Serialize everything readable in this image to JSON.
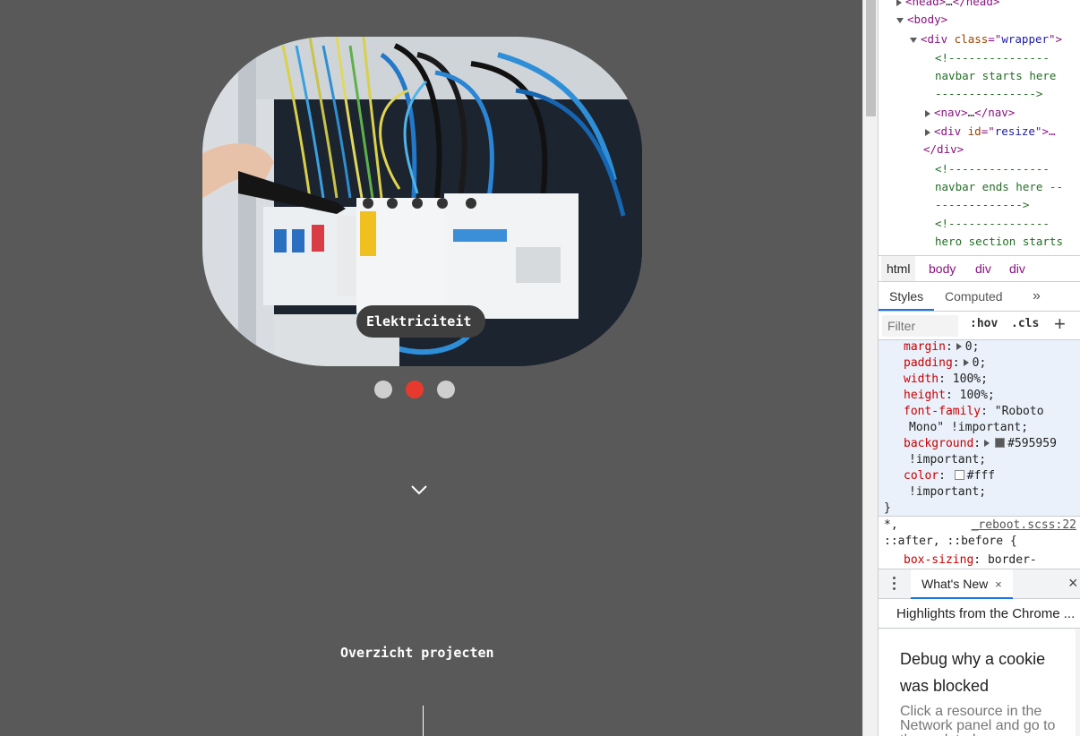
{
  "page": {
    "hero_caption": "Elektriciteit",
    "carousel": {
      "slide_count": 3,
      "active_index": 1,
      "active_color": "#e8392e",
      "inactive_color": "#cfcfcf"
    },
    "background_color": "#595959",
    "projects_title": "Overzicht projecten"
  },
  "devtools": {
    "elements": {
      "head_tag_open": "<head>",
      "head_ellipsis": "…",
      "head_tag_close": "</head>",
      "body_tag": "<body>",
      "wrapper_tag_open": "<div ",
      "wrapper_attr": "class",
      "wrapper_eq": "=\"",
      "wrapper_val": "wrapper",
      "wrapper_close": "\">",
      "comment_navbar_start_1": "<!---------------",
      "comment_navbar_start_2": "navbar starts here",
      "comment_navbar_start_3": "--------------->",
      "nav_open": "<nav>",
      "nav_ellipsis": "…",
      "nav_close": "</nav>",
      "resize_open": "<div ",
      "resize_attr": "id",
      "resize_eq": "=\"",
      "resize_val": "resize",
      "resize_close": "\">…",
      "div_close": "</div>",
      "comment_navbar_end_1": "<!---------------",
      "comment_navbar_end_2": "navbar ends here --",
      "comment_navbar_end_3": "------------->",
      "comment_hero_1": "<!---------------",
      "comment_hero_2": "hero section starts"
    },
    "breadcrumb": [
      "html",
      "body",
      "div",
      "div"
    ],
    "tabs": {
      "styles": "Styles",
      "computed": "Computed",
      "more": "»"
    },
    "filter": {
      "placeholder": "Filter",
      "hov": ":hov",
      "cls": ".cls",
      "add": "+"
    },
    "styles_rule": [
      {
        "prop": "margin",
        "value": "0;",
        "tri": true
      },
      {
        "prop": "padding",
        "value": "0;",
        "tri": true
      },
      {
        "prop": "width",
        "value": "100%;"
      },
      {
        "prop": "height",
        "value": "100%;"
      },
      {
        "prop": "font-family",
        "value": "\"Roboto"
      },
      {
        "cont": "Mono\" !important;"
      },
      {
        "prop": "background",
        "value": "#595959",
        "tri": true,
        "swatch": "#595959"
      },
      {
        "cont": "!important;"
      },
      {
        "prop": "color",
        "value": "#fff",
        "swatch": "#ffffff"
      },
      {
        "cont": "!important;"
      },
      {
        "brace": "}"
      }
    ],
    "reboot": {
      "selector_1": "*,",
      "selector_2": "::after, ::before {",
      "link": "_reboot.scss:22",
      "prop": "box-sizing",
      "value": "border-"
    },
    "drawer": {
      "tab": "What's New",
      "tab_close": "×",
      "close": "×",
      "header": "Highlights from the Chrome ...",
      "card_title": "Debug why a cookie was blocked",
      "card_body": "Click a resource in the Network panel and go to the updated"
    }
  }
}
